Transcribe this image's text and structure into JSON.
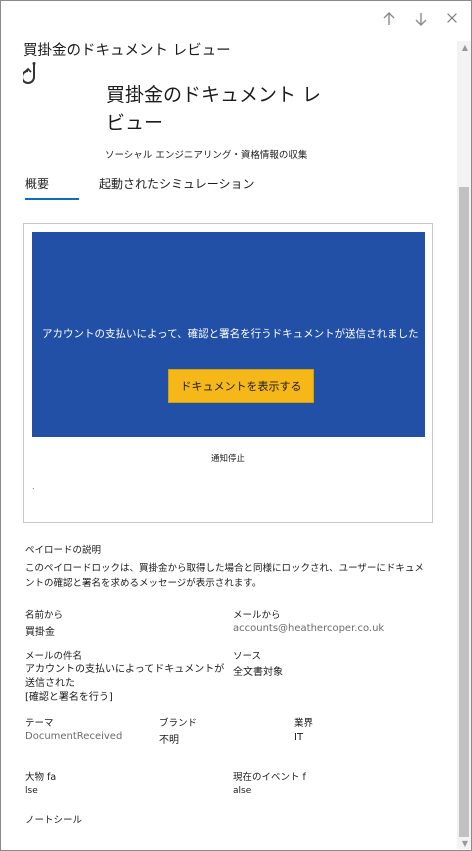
{
  "panel": {
    "title": "買掛金のドキュメント レビュー",
    "big_title_line1": "買掛金のドキュメント レ",
    "big_title_line2": "ビュー",
    "subtitle": "ソーシャル エンジニアリング・資格情報の収集"
  },
  "tabs": [
    {
      "label": "概要",
      "selected": true
    },
    {
      "label": "起動されたシミュレーション",
      "selected": false
    }
  ],
  "preview": {
    "email_text": "アカウントの支払いによって、確認と署名を行うドキュメントが送信されました",
    "button_label": "ドキュメントを表示する",
    "unsubscribe": "通知停止",
    "tiny_text": "."
  },
  "payload_description": {
    "label": "ペイロードの説明",
    "text": "このペイロードロックは、買掛金から取得した場合と同様にロックされ、ユーザーにドキュメントの確認と署名を求めるメッセージが表示されます。"
  },
  "fields": {
    "from_name_label": "名前から",
    "from_name_value": "買掛金",
    "from_email_label": "メールから",
    "from_email_value": "accounts@heathercoper.co.uk",
    "subject_label": "メールの件名",
    "subject_line1": "アカウントの支払いによってドキュメントが送信された",
    "subject_line2": "[確認と署名を行う]",
    "source_label": "ソース",
    "source_value": "全文書対象",
    "theme_label": "テーマ",
    "theme_value": "DocumentReceived",
    "brand_label": "ブランド",
    "brand_value": "不明",
    "industry_label": "業界",
    "industry_value": "IT",
    "major_label": "大物 fa",
    "major_value": "lse",
    "current_event_label": "現在のイベント f",
    "current_event_value": "alse",
    "note_label": "ノートシール"
  },
  "icons": {
    "prev": "arrow-up-icon",
    "next": "arrow-down-icon",
    "close": "close-icon",
    "hook": "phishing-hook-icon"
  },
  "colors": {
    "banner": "#2150a6",
    "button": "#f6b718",
    "tab_underline": "#0f6cbd"
  }
}
